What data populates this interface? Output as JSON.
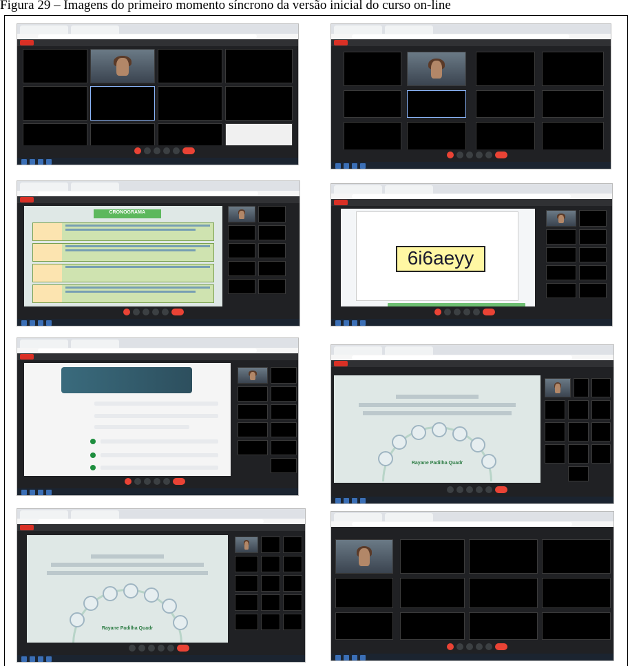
{
  "caption": "Figura 29 – Imagens do primeiro momento síncrono da versão inicial do curso on-line",
  "shots": [
    {
      "id": "top-left",
      "kind": "grid"
    },
    {
      "id": "top-right",
      "kind": "grid"
    },
    {
      "id": "row2-left",
      "kind": "schedule",
      "slide_title": "CRONOGRAMA"
    },
    {
      "id": "row2-right",
      "kind": "code",
      "code_text": "6i6aeyy"
    },
    {
      "id": "row3-left",
      "kind": "classroom"
    },
    {
      "id": "row3-right",
      "kind": "title-slide",
      "author": "Rayane Padilha Quadr"
    },
    {
      "id": "bottom-left",
      "kind": "title-slide",
      "author": "Rayane Padilha Quadr"
    },
    {
      "id": "bottom-right",
      "kind": "grid"
    }
  ],
  "colors": {
    "meet_bg": "#202124",
    "end_call": "#ea4335",
    "code_bg": "#fff7a3",
    "link": "#6fbf73",
    "sched_header": "#5cb85c"
  }
}
